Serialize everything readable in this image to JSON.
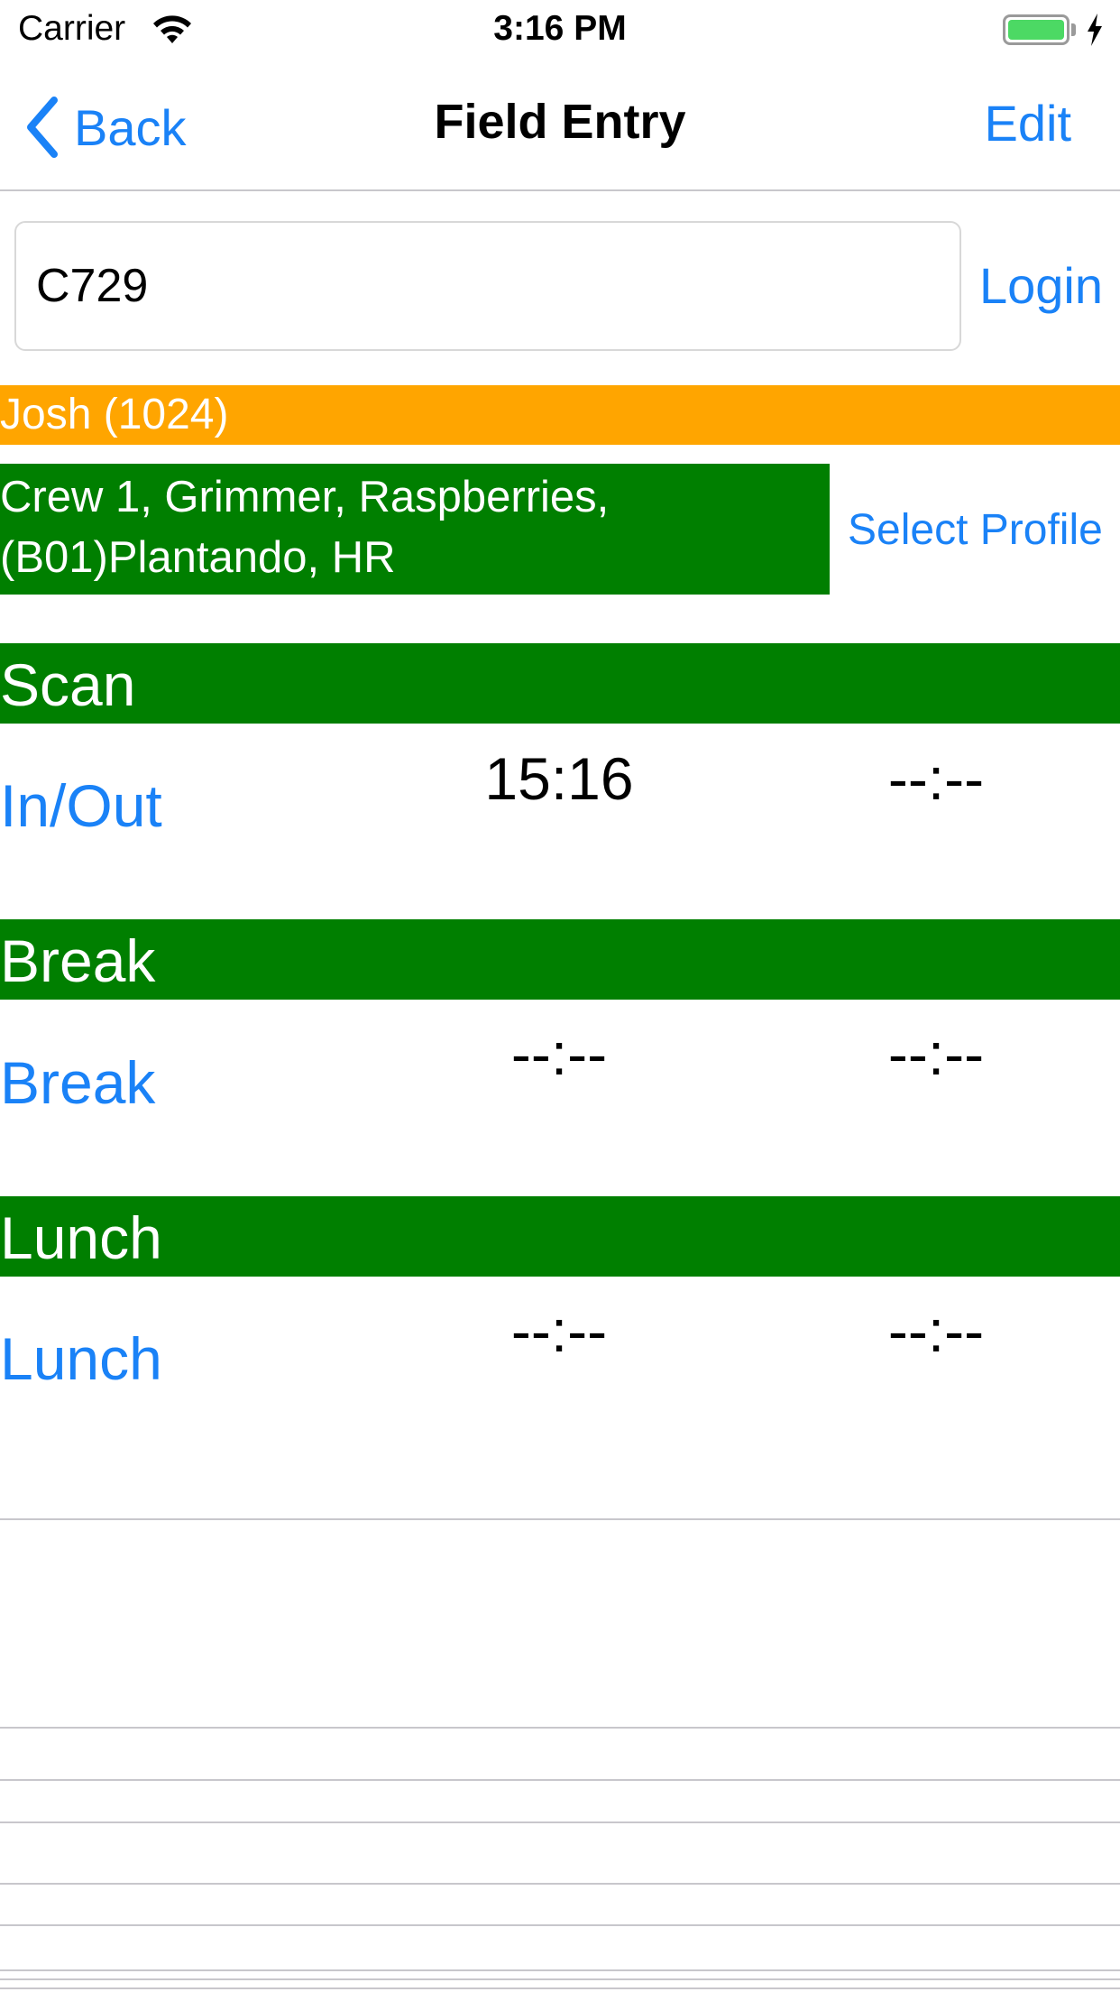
{
  "status_bar": {
    "carrier": "Carrier",
    "time": "3:16 PM",
    "icons": [
      "wifi-icon",
      "battery-icon",
      "charging-bolt-icon"
    ]
  },
  "nav": {
    "back_label": "Back",
    "title": "Field Entry",
    "edit_label": "Edit"
  },
  "login": {
    "input_value": "C729",
    "button_label": "Login"
  },
  "user_banner": "Josh (1024)",
  "profile": {
    "line1": "Crew 1, Grimmer, Raspberries,",
    "line2": "(B01)Plantando, HR",
    "select_label": "Select Profile"
  },
  "sections": [
    {
      "header": "Scan",
      "action": "In/Out",
      "time_in": "15:16",
      "time_out": "--:--"
    },
    {
      "header": "Break",
      "action": "Break",
      "time_in": "--:--",
      "time_out": "--:--"
    },
    {
      "header": "Lunch",
      "action": "Lunch",
      "time_in": "--:--",
      "time_out": "--:--"
    }
  ],
  "colors": {
    "accent_blue": "#1a82f7",
    "section_green": "#007f00",
    "user_orange": "#ffa500",
    "battery_green": "#4cd964"
  }
}
